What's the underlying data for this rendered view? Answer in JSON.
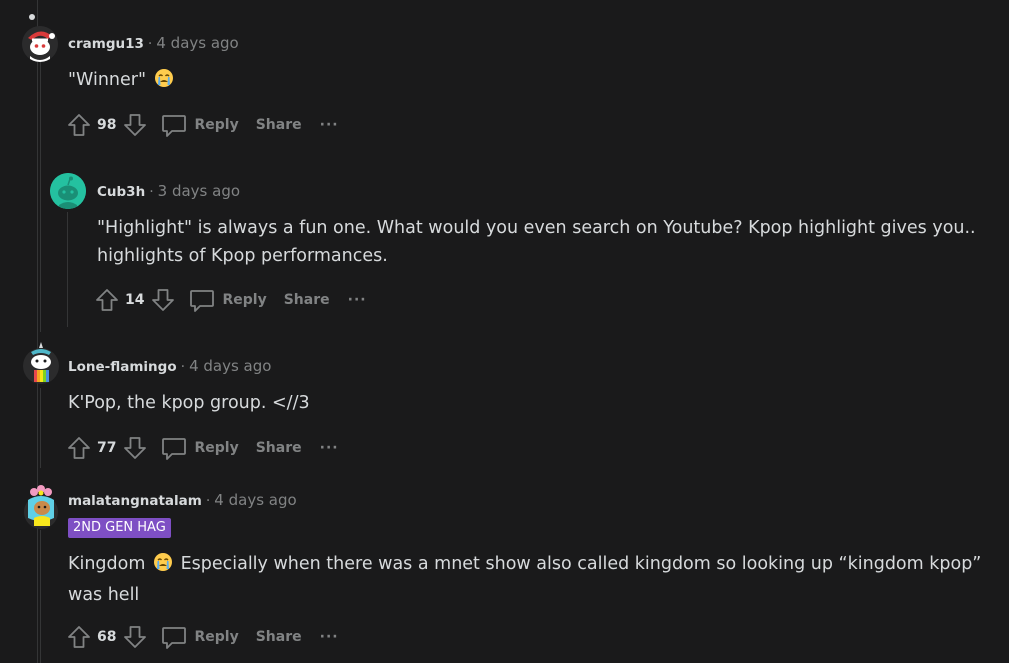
{
  "comments": [
    {
      "author": "cramgu13",
      "time": "4 days ago",
      "body_parts": [
        "\"Winner\""
      ],
      "votes": "98",
      "reply_label": "Reply",
      "share_label": "Share",
      "more_label": "···",
      "avatar_icon": "snoo-santa-avatar-icon"
    },
    {
      "author": "Cub3h",
      "time": "3 days ago",
      "body_parts": [
        "\"Highlight\" is always a fun one. What would you even search on Youtube? Kpop highlight gives you.. highlights of Kpop performances."
      ],
      "votes": "14",
      "reply_label": "Reply",
      "share_label": "Share",
      "more_label": "···",
      "avatar_icon": "snoo-default-avatar-icon"
    },
    {
      "author": "Lone-flamingo",
      "time": "4 days ago",
      "body_parts": [
        "K'Pop, the kpop group. <//3"
      ],
      "votes": "77",
      "reply_label": "Reply",
      "share_label": "Share",
      "more_label": "···",
      "avatar_icon": "snoo-rainbow-avatar-icon"
    },
    {
      "author": "malatangnatalam",
      "time": "4 days ago",
      "flair": "2ND GEN HAG",
      "body_parts": [
        "Kingdom",
        "Especially when there was a mnet show also called kingdom so looking up “kingdom kpop” was hell"
      ],
      "votes": "68",
      "reply_label": "Reply",
      "share_label": "Share",
      "more_label": "···",
      "avatar_icon": "snoo-flower-avatar-icon"
    }
  ],
  "separator": "·",
  "colors": {
    "background": "#1a1a1b",
    "text": "#d7dadc",
    "muted": "#818384",
    "thread_line": "#343536",
    "flair_bg": "#7e4fc4"
  }
}
